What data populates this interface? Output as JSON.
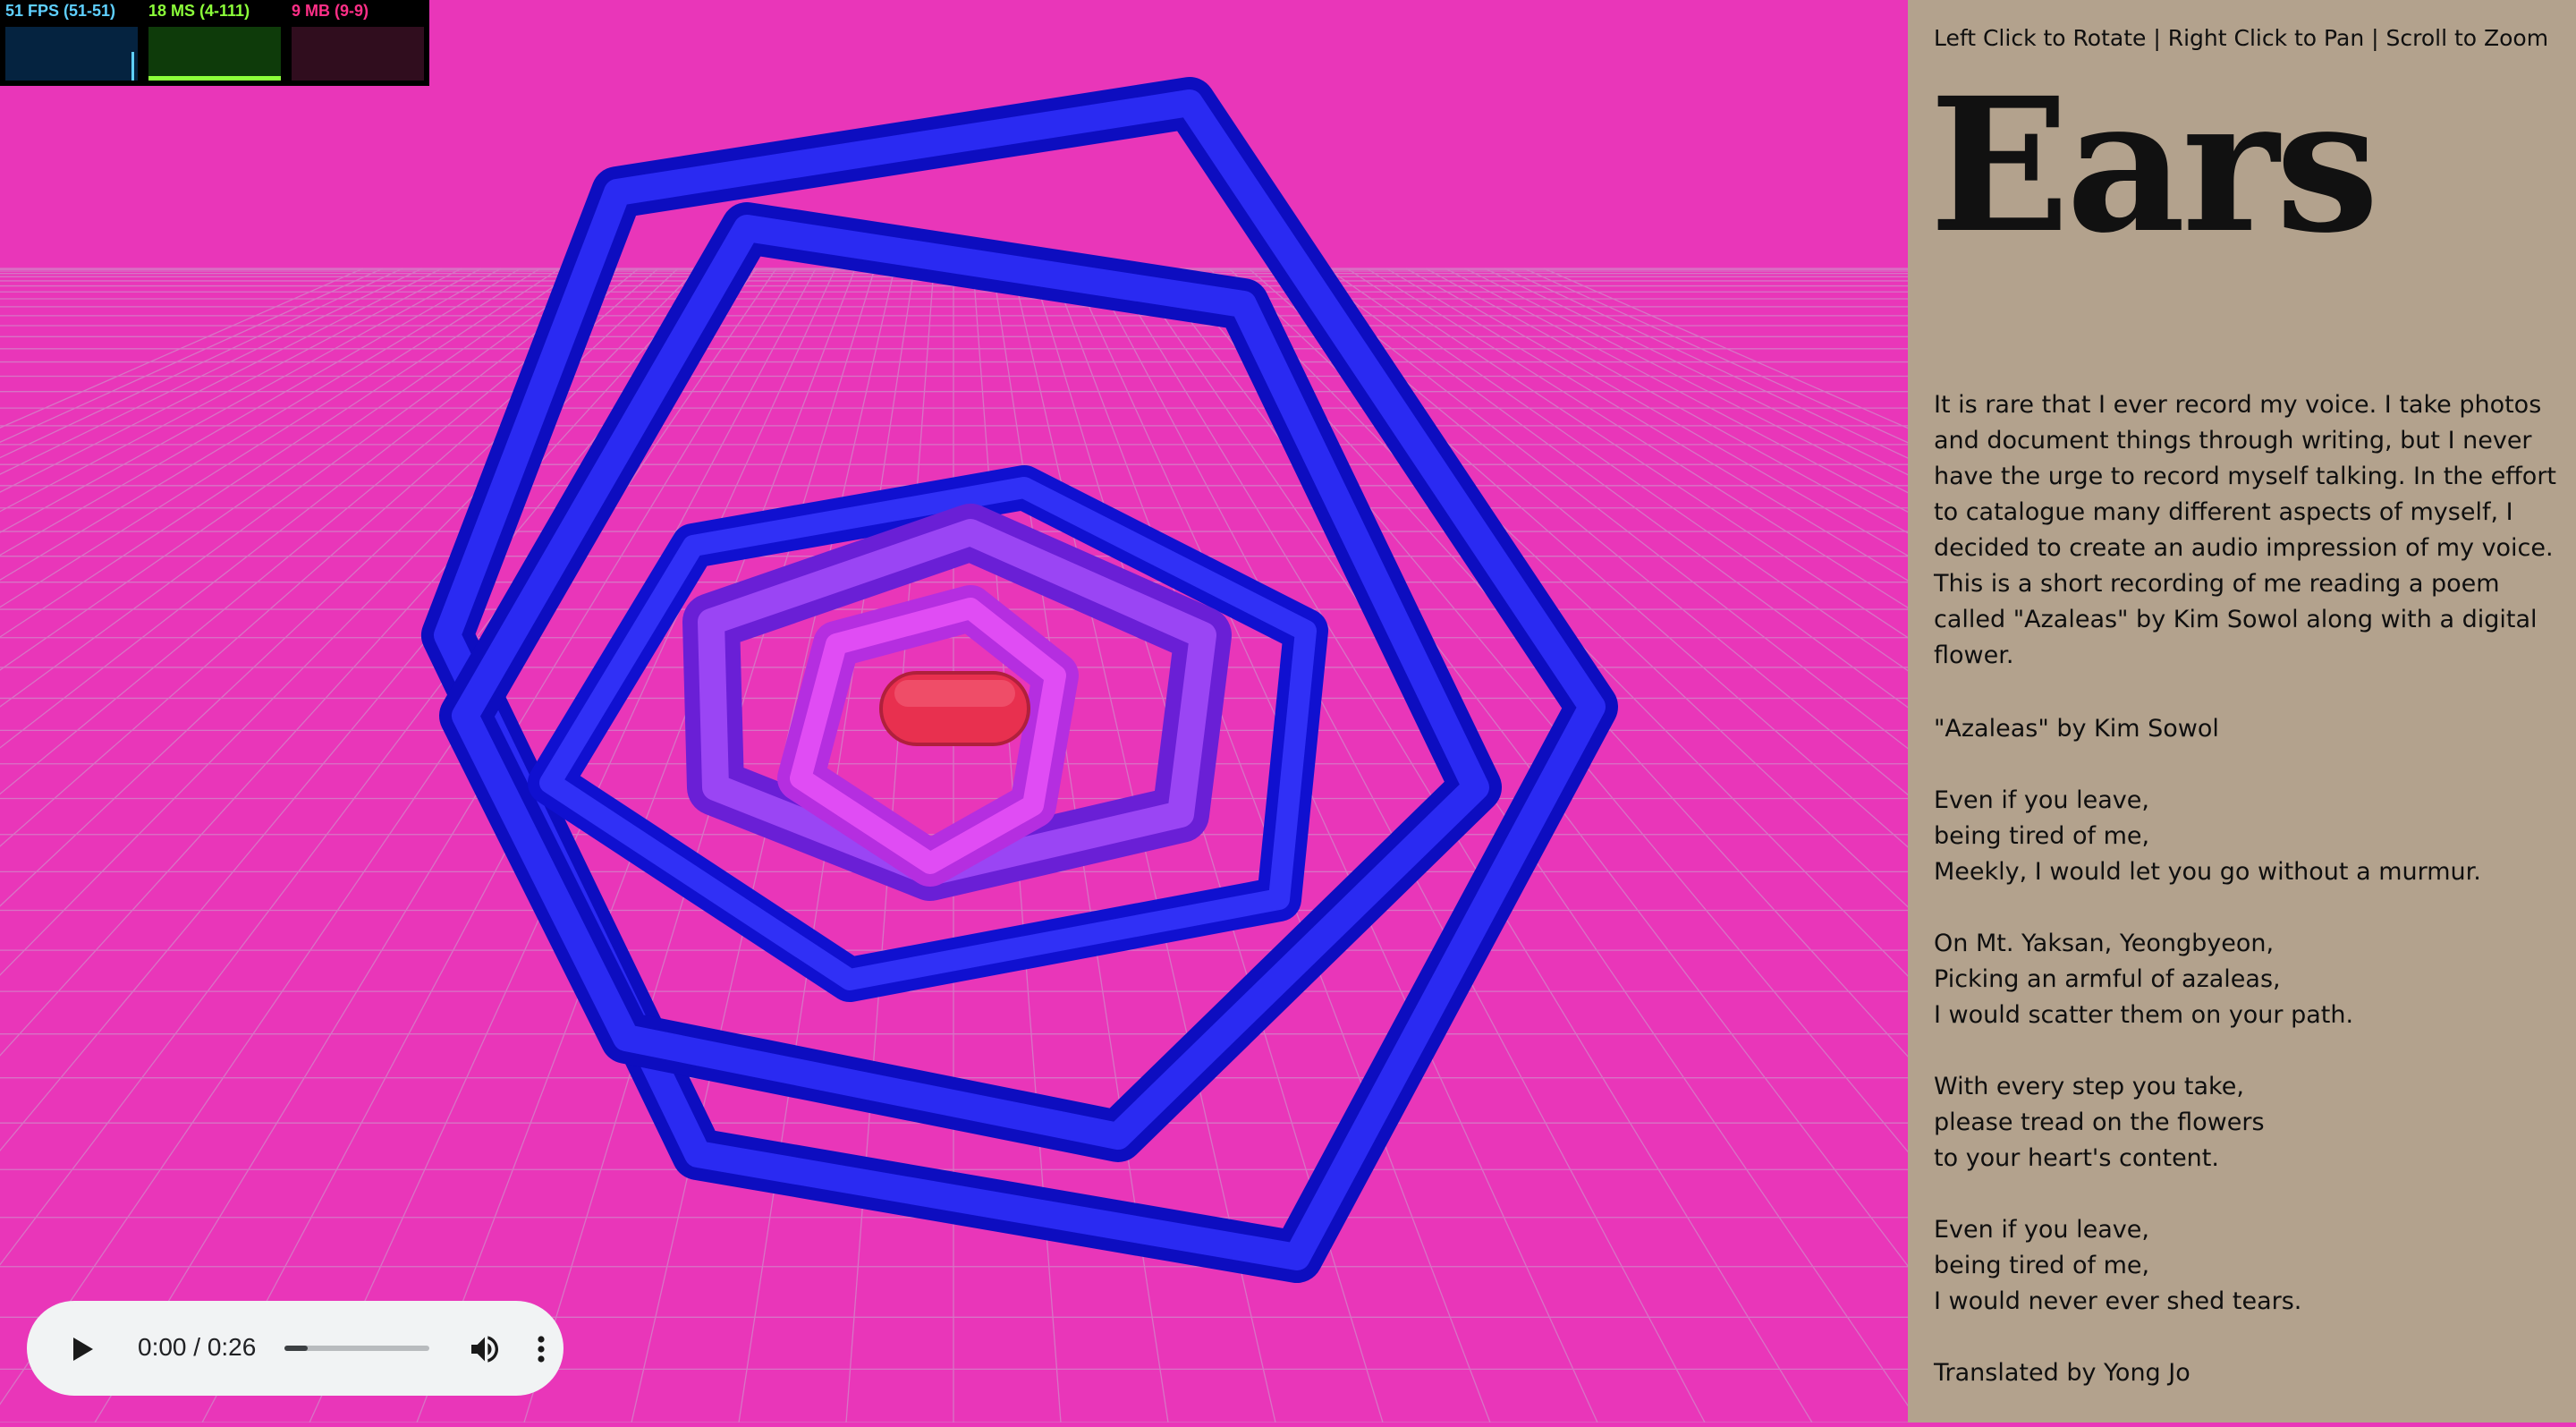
{
  "stats": {
    "fps": "51 FPS (51-51)",
    "ms": "18 MS (4-111)",
    "mb": "9 MB (9-9)"
  },
  "audio": {
    "time": "0:00 / 0:26",
    "progress_fraction": 0.0,
    "play_icon": "play-icon",
    "volume_icon": "volume-icon",
    "menu_icon": "more-vert-icon"
  },
  "panel": {
    "controls_hint": "Left Click to Rotate | Right Click to Pan | Scroll to Zoom",
    "title": "Ears",
    "intro": "It is rare that I ever record my voice. I take photos and document things through writing, but I never have the urge to record myself talking. In the effort to catalogue many different aspects of myself, I decided to create an audio impression of my voice. This is a short recording of me reading a poem called \"Azaleas\" by Kim Sowol along with a digital flower.",
    "poem_heading": "\"Azaleas\" by Kim Sowol",
    "stanzas": [
      [
        "Even if you leave,",
        "being tired of me,",
        "Meekly, I would let you go without a murmur."
      ],
      [
        "On Mt. Yaksan, Yeongbyeon,",
        "Picking an armful of azaleas,",
        "I would scatter them on your path."
      ],
      [
        "With every step you take,",
        "please tread on the flowers",
        "to your heart's content."
      ],
      [
        "Even if you leave,",
        "being tired of me,",
        "I would never ever shed tears."
      ]
    ],
    "credit": "Translated by Yong Jo"
  },
  "colors": {
    "background": "#e936b9",
    "panel": "#b3a28d",
    "outer_ring": "#1616e6",
    "inner_ring": "#8a2cf0",
    "core_ring": "#d63cf2",
    "center": "#e8304f"
  }
}
